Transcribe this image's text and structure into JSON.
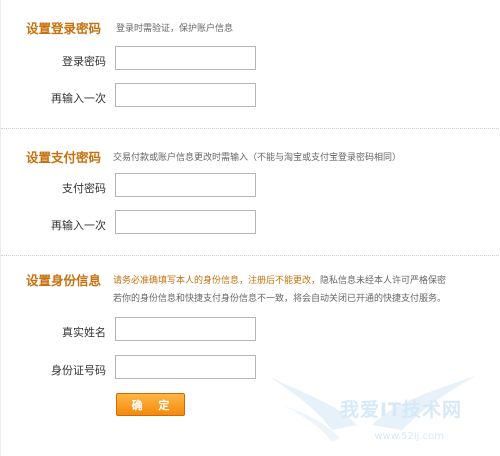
{
  "login_section": {
    "title": "设置登录密码",
    "description": "登录时需验证，保护账户信息",
    "password_label": "登录密码",
    "repeat_label": "再输入一次"
  },
  "pay_section": {
    "title": "设置支付密码",
    "description": "交易付款或账户信息更改时需输入（不能与淘宝或支付宝登录密码相同）",
    "password_label": "支付密码",
    "repeat_label": "再输入一次"
  },
  "identity_section": {
    "title": "设置身份信息",
    "notice_highlight": "请务必准确填写本人的身份信息，注册后不能更改，",
    "notice_rest": "隐私信息未经本人许可严格保密",
    "notice_line2": "若你的身份信息和快捷支付身份信息不一致，将会自动关闭已开通的快捷支付服务。",
    "name_label": "真实姓名",
    "id_label": "身份证号码"
  },
  "confirm_label": "确 定",
  "watermark": {
    "text": "我爱IT技术网",
    "url": "www.52ij.com"
  },
  "colors": {
    "title": "#c8700e",
    "button": "#f38a0c",
    "input_border": "#b7b7b7"
  }
}
